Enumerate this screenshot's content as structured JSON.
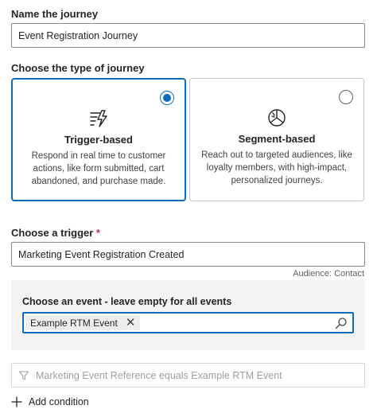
{
  "journey_name": {
    "label": "Name the journey",
    "value": "Event Registration Journey"
  },
  "journey_type": {
    "label": "Choose the type of journey",
    "options": [
      {
        "title": "Trigger-based",
        "description": "Respond in real time to customer actions, like form submitted, cart abandoned, and purchase made.",
        "selected": true,
        "icon": "trigger-icon"
      },
      {
        "title": "Segment-based",
        "description": "Reach out to targeted audiences, like loyalty members, with high-impact, personalized journeys.",
        "selected": false,
        "icon": "segment-pie-icon"
      }
    ]
  },
  "trigger": {
    "label": "Choose a trigger",
    "required_mark": "*",
    "value": "Marketing Event Registration Created",
    "audience": "Audience: Contact"
  },
  "event": {
    "label": "Choose an event - leave empty for all events",
    "chip": "Example RTM Event",
    "chip_remove": "✕"
  },
  "condition_filter": {
    "text": "Marketing Event Reference equals Example RTM Event",
    "icon": "filter-icon"
  },
  "add_condition": {
    "label": "Add condition",
    "icon": "plus-icon"
  },
  "colors": {
    "accent": "#0f6cbd",
    "required": "#c4314b",
    "panel_bg": "#f3f3f3"
  }
}
